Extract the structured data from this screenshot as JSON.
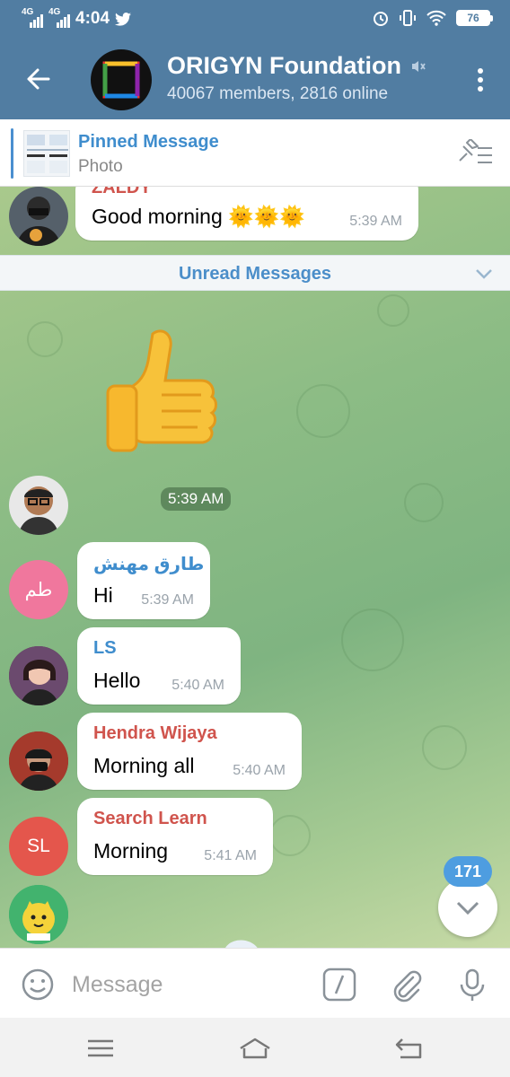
{
  "status": {
    "network1": "4G",
    "network2": "4G",
    "time": "4:04",
    "battery": "76"
  },
  "header": {
    "title": "ORIGYN Foundation",
    "subtitle": "40067 members, 2816 online"
  },
  "pinned": {
    "title": "Pinned Message",
    "subtitle": "Photo"
  },
  "partial_message": {
    "sender": "ZALDY",
    "text": "Good morning 🌞🌞🌞",
    "time": "5:39 AM"
  },
  "unread": {
    "label": "Unread Messages"
  },
  "sticker": {
    "time": "5:39 AM"
  },
  "messages": [
    {
      "avatar_initials": "طم",
      "avatar_color": "#f0779d",
      "sender": "طارق مهنش",
      "sender_color": "#3f8dcd",
      "text": "Hi",
      "time": "5:39 AM"
    },
    {
      "avatar_initials": "",
      "avatar_color": "#5a3a4a",
      "sender": "LS",
      "sender_color": "#3f8dcd",
      "text": "Hello",
      "time": "5:40 AM"
    },
    {
      "avatar_initials": "",
      "avatar_color": "#8a3030",
      "sender": "Hendra Wijaya",
      "sender_color": "#d0544d",
      "text": "Morning all",
      "time": "5:40 AM"
    },
    {
      "avatar_initials": "SL",
      "avatar_color": "#e4564c",
      "sender": "Search Learn",
      "sender_color": "#d0544d",
      "text": "Morning",
      "time": "5:41 AM"
    }
  ],
  "scroll_badge": "171",
  "input": {
    "placeholder": "Message"
  },
  "icons": [
    "back-arrow-icon",
    "mute-icon",
    "menu-dots-icon",
    "unpin-icon",
    "chevron-down-icon",
    "emoji-icon",
    "bot-command-icon",
    "attach-icon",
    "mic-icon",
    "nav-menu-icon",
    "nav-home-icon",
    "nav-back-icon"
  ],
  "colors": {
    "header": "#517da2",
    "accent": "#3f8dcd",
    "badge": "#4e9de0"
  }
}
